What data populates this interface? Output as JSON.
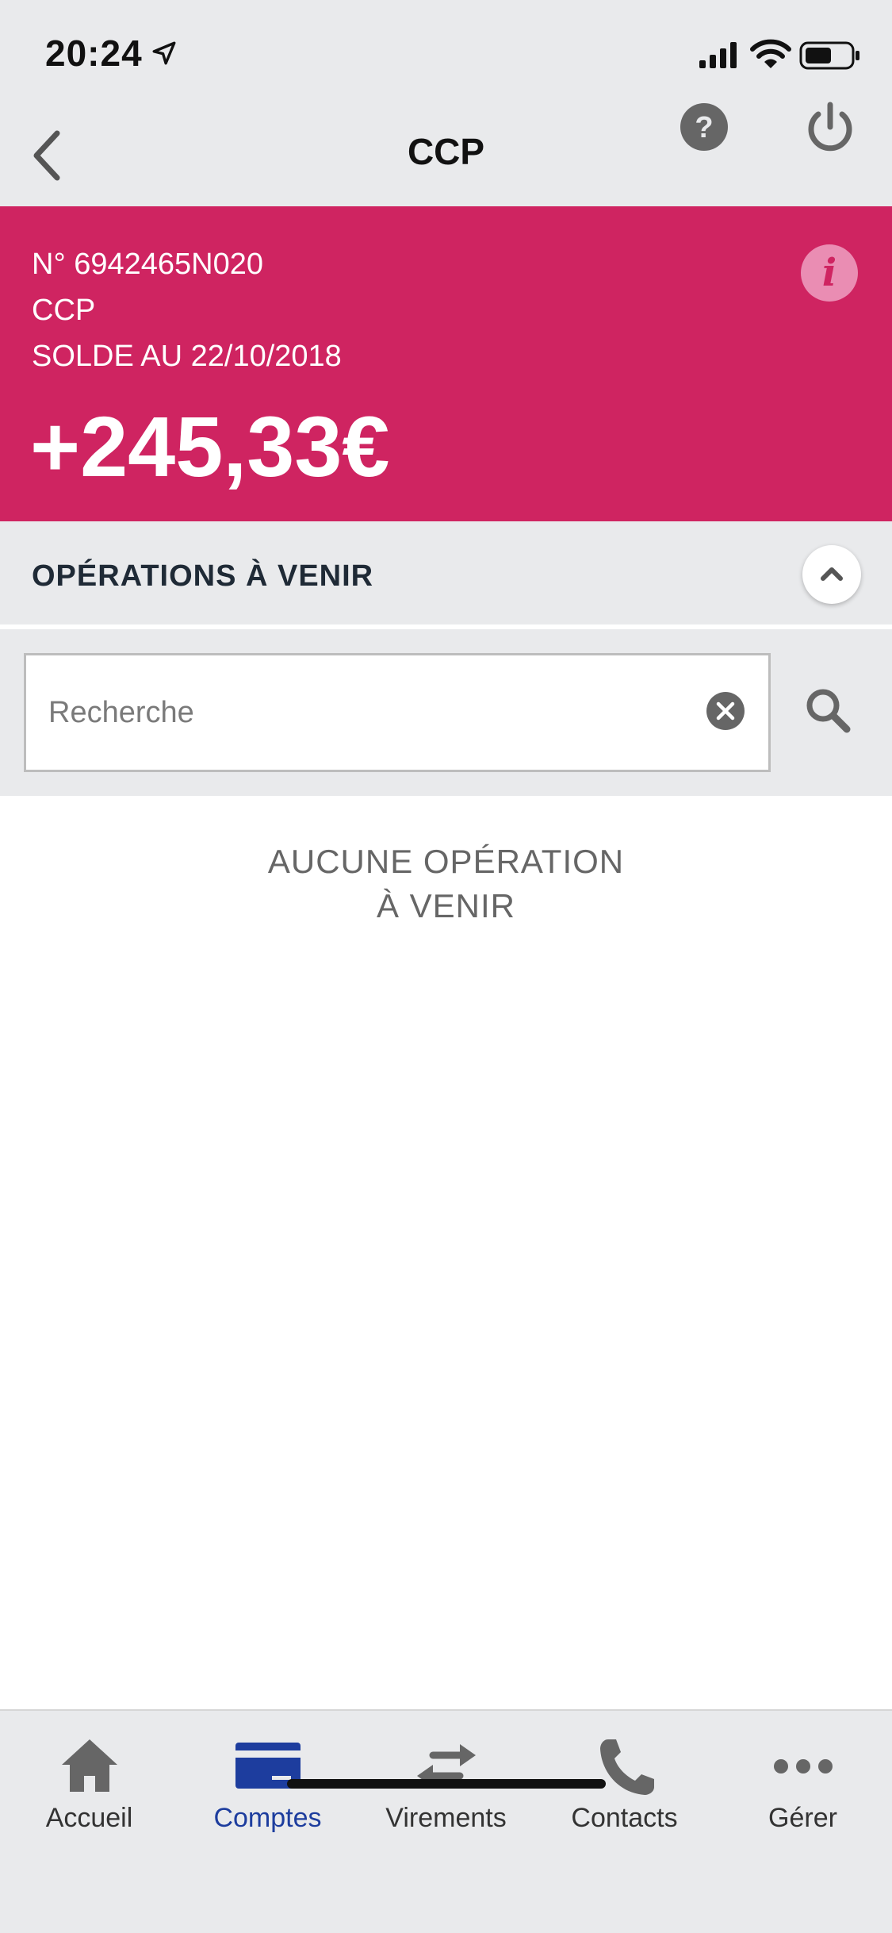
{
  "statusbar": {
    "time": "20:24"
  },
  "nav": {
    "title": "CCP"
  },
  "account": {
    "number": "N° 6942465N020",
    "type": "CCP",
    "date": "SOLDE AU 22/10/2018",
    "balance": "+245,33€"
  },
  "section": {
    "title": "OPÉRATIONS À VENIR"
  },
  "search": {
    "placeholder": "Recherche",
    "value": ""
  },
  "empty": {
    "line1": "AUCUNE OPÉRATION",
    "line2": "À VENIR"
  },
  "tabs": [
    {
      "label": "Accueil",
      "icon": "home-icon"
    },
    {
      "label": "Comptes",
      "icon": "card-icon",
      "active": true
    },
    {
      "label": "Virements",
      "icon": "transfer-icon"
    },
    {
      "label": "Contacts",
      "icon": "phone-icon"
    },
    {
      "label": "Gérer",
      "icon": "more-icon"
    }
  ],
  "colors": {
    "accent": "#cf2461",
    "active_tab": "#1d3d9e",
    "background": "#e9eaec"
  }
}
